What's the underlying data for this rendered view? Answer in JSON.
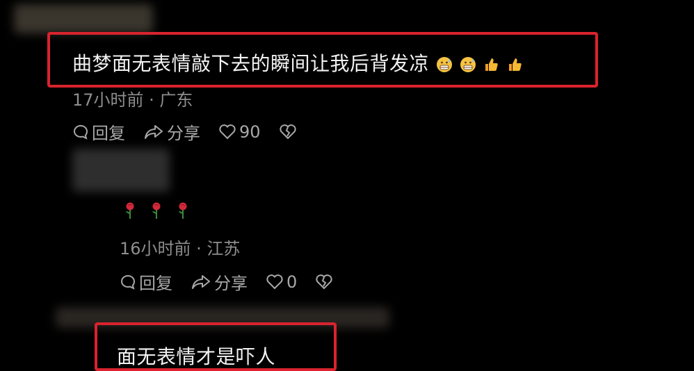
{
  "comment1": {
    "text": "曲梦面无表情敲下去的瞬间让我后背发凉",
    "emojis": [
      "grimace-sweat-emoji",
      "grimace-sweat-emoji",
      "thumbs-up-emoji",
      "thumbs-up-emoji"
    ],
    "meta": "17小时前 · 广东",
    "reply_label": "回复",
    "share_label": "分享",
    "like_count": "90"
  },
  "comment2": {
    "emojis": [
      "rose-emoji",
      "rose-emoji",
      "rose-emoji"
    ],
    "meta": "16小时前 · 江苏",
    "reply_label": "回复",
    "share_label": "分享",
    "like_count": "0"
  },
  "comment3": {
    "text": "面无表情才是吓人"
  },
  "colors": {
    "highlight": "#d9232e",
    "background": "#000000",
    "meta": "#8e8e8e",
    "action": "#a8a8a8"
  }
}
